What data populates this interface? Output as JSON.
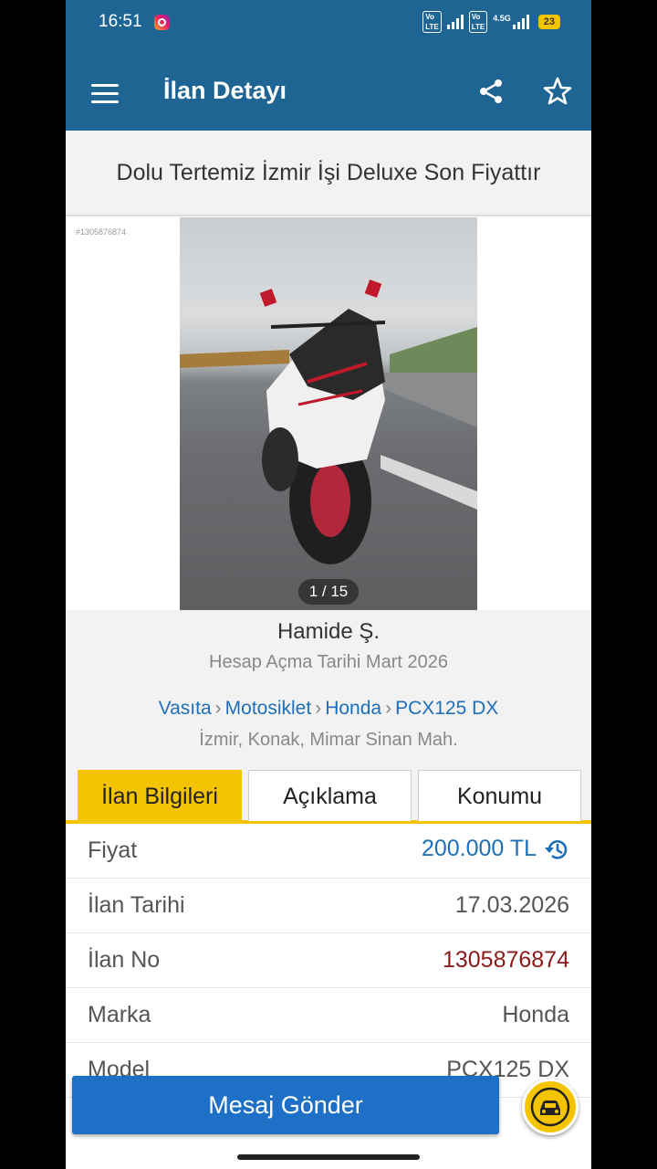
{
  "status_bar": {
    "time": "16:51",
    "network": "4.5G",
    "volte": "Vo LTE",
    "battery": "23"
  },
  "app_bar": {
    "title": "İlan Detayı"
  },
  "listing": {
    "title": "Dolu Tertemiz İzmir İşi Deluxe Son Fiyattır",
    "ad_id_watermark": "#1305876874"
  },
  "gallery": {
    "counter": "1 / 15"
  },
  "seller": {
    "name": "Hamide Ş.",
    "account_date": "Hesap Açma Tarihi  Mart 2026"
  },
  "breadcrumb": [
    "Vasıta",
    "Motosiklet",
    "Honda",
    "PCX125 DX"
  ],
  "location": "İzmir, Konak, Mimar Sinan Mah.",
  "tabs": [
    {
      "label": "İlan Bilgileri",
      "active": true
    },
    {
      "label": "Açıklama",
      "active": false
    },
    {
      "label": "Konumu",
      "active": false
    }
  ],
  "info_rows": [
    {
      "key": "Fiyat",
      "value": "200.000 TL"
    },
    {
      "key": "İlan Tarihi",
      "value": "17.03.2026"
    },
    {
      "key": "İlan No",
      "value": "1305876874"
    },
    {
      "key": "Marka",
      "value": "Honda"
    },
    {
      "key": "Model",
      "value": "PCX125 DX"
    }
  ],
  "actions": {
    "message_button": "Mesaj Gönder"
  },
  "colors": {
    "primary": "#1e6593",
    "accent": "#f5c400",
    "link": "#1e6fb8",
    "ad_no": "#8b1a1a"
  }
}
